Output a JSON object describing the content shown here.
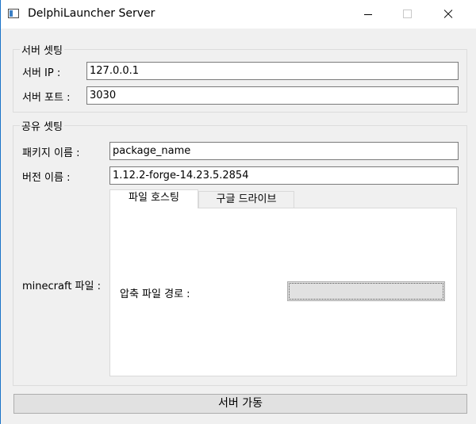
{
  "window": {
    "title": "DelphiLauncher Server"
  },
  "server_group": {
    "title": "서버 셋팅",
    "ip_label": "서버 IP :",
    "ip_value": "127.0.0.1",
    "port_label": "서버 포트 :",
    "port_value": "3030"
  },
  "share_group": {
    "title": "공유 셋팅",
    "package_label": "패키지 이름 :",
    "package_value": "package_name",
    "version_label": "버전 이름 :",
    "version_value": "1.12.2-forge-14.23.5.2854",
    "minecraft_label": "minecraft 파일 :",
    "tabs": [
      {
        "label": "파일 호스팅",
        "active": true
      },
      {
        "label": "구글 드라이브",
        "active": false
      }
    ],
    "archive_path_label": "압축 파일 경로 :",
    "archive_path_button": ""
  },
  "start_button": "서버 가동"
}
